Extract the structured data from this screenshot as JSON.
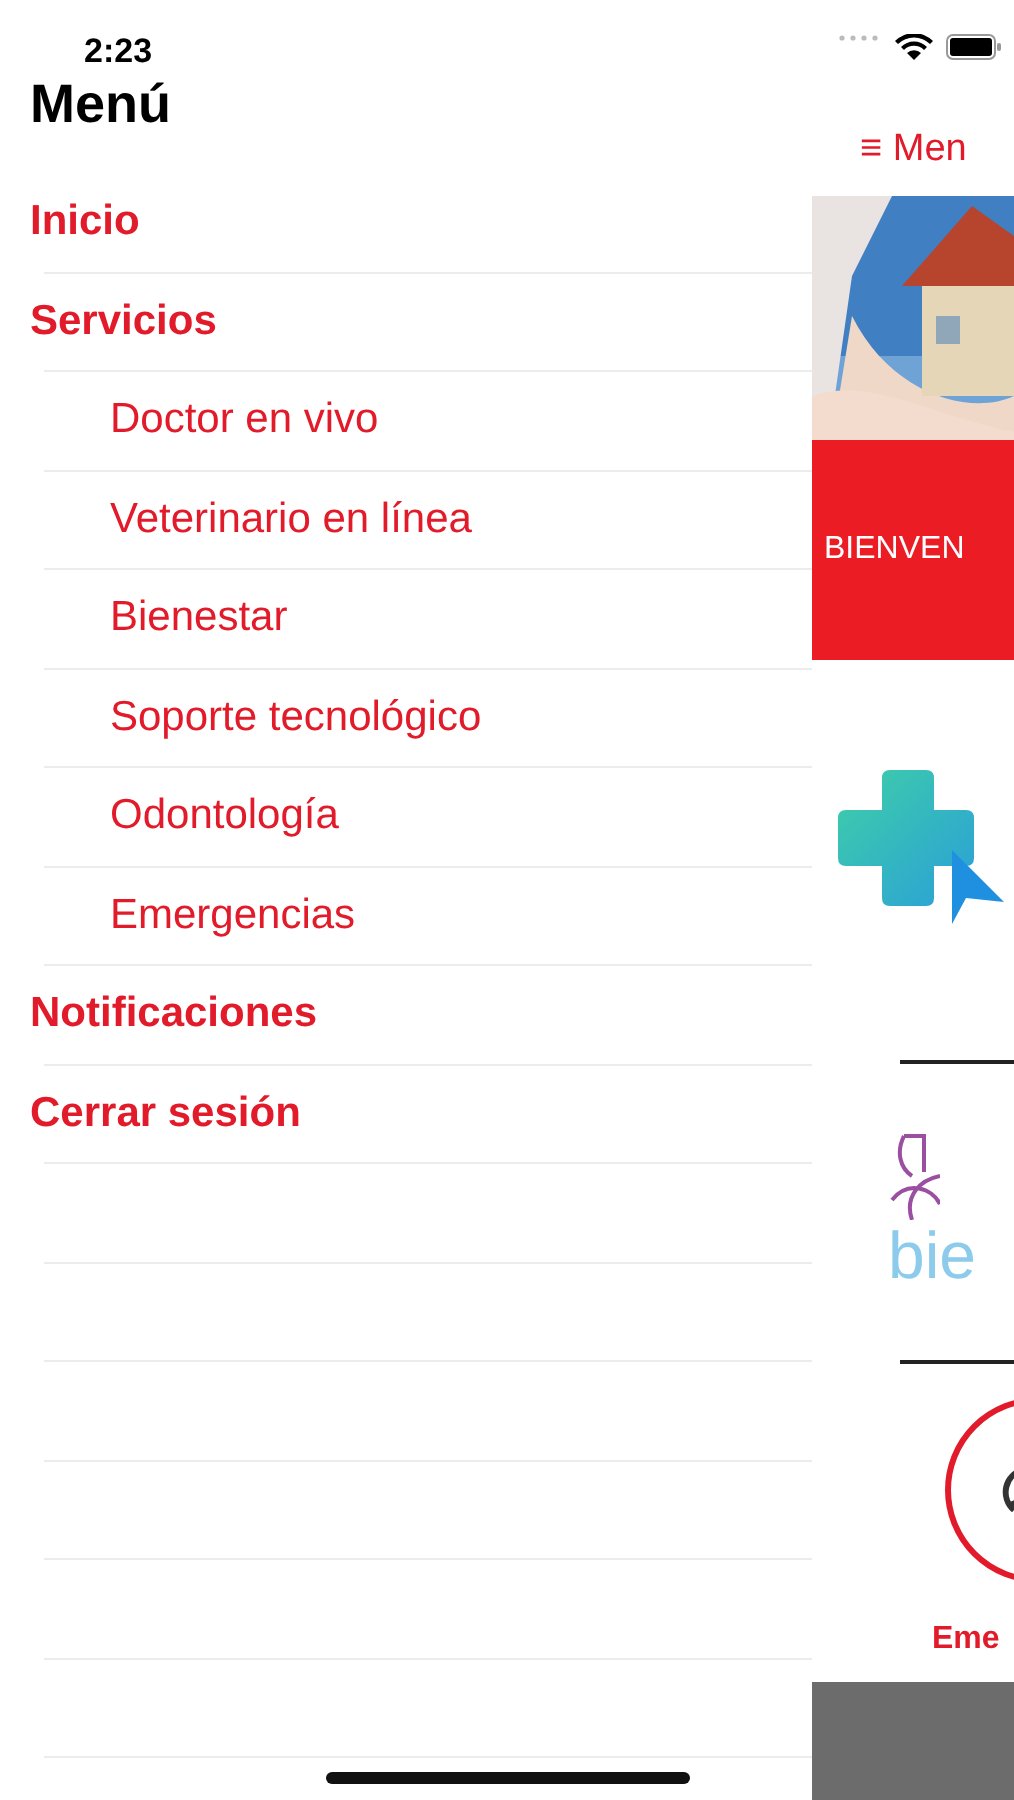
{
  "status_bar": {
    "time": "2:23"
  },
  "drawer": {
    "title": "Menú",
    "items": [
      {
        "label": "Inicio"
      },
      {
        "label": "Servicios",
        "children": [
          {
            "label": "Doctor en vivo"
          },
          {
            "label": "Veterinario en línea"
          },
          {
            "label": "Bienestar"
          },
          {
            "label": "Soporte tecnológico"
          },
          {
            "label": "Odontología"
          },
          {
            "label": "Emergencias"
          }
        ]
      },
      {
        "label": "Notificaciones"
      },
      {
        "label": "Cerrar sesión"
      }
    ]
  },
  "page": {
    "menu_button": "≡ Men",
    "banner_text": "BIENVEN",
    "wellness_text": "bie",
    "emergency_text": "Eme"
  }
}
